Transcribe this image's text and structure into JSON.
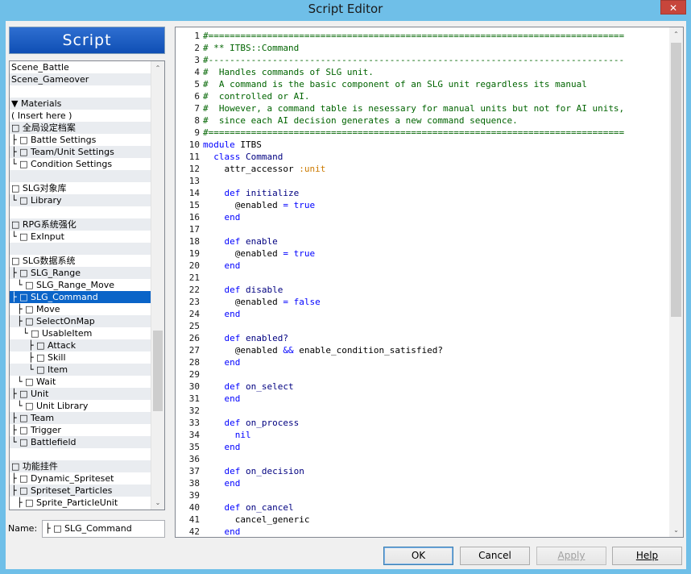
{
  "window": {
    "title": "Script Editor",
    "close_glyph": "✕"
  },
  "banner": {
    "label": "Script"
  },
  "script_list": {
    "items": [
      {
        "label": "Scene_Battle",
        "style": "normal"
      },
      {
        "label": "Scene_Gameover",
        "style": "alt"
      },
      {
        "label": "",
        "style": "normal"
      },
      {
        "label": "▼ Materials",
        "style": "alt"
      },
      {
        "label": "( Insert here )",
        "style": "normal"
      },
      {
        "label": "□ 全局设定档案",
        "style": "alt"
      },
      {
        "label": "├ □ Battle Settings",
        "style": "normal"
      },
      {
        "label": "├ □ Team/Unit Settings",
        "style": "alt"
      },
      {
        "label": "└ □ Condition Settings",
        "style": "normal"
      },
      {
        "label": "",
        "style": "alt"
      },
      {
        "label": "□ SLG对象库",
        "style": "normal"
      },
      {
        "label": "└ □ Library",
        "style": "alt"
      },
      {
        "label": "",
        "style": "normal"
      },
      {
        "label": "□ RPG系统强化",
        "style": "alt"
      },
      {
        "label": "└ □ ExInput",
        "style": "normal"
      },
      {
        "label": "",
        "style": "alt"
      },
      {
        "label": "□ SLG数据系统",
        "style": "normal"
      },
      {
        "label": "├ □ SLG_Range",
        "style": "alt"
      },
      {
        "label": "  └ □ SLG_Range_Move",
        "style": "normal"
      },
      {
        "label": "├ □ SLG_Command",
        "style": "sel"
      },
      {
        "label": "  ├ □ Move",
        "style": "normal"
      },
      {
        "label": "  ├ □ SelectOnMap",
        "style": "alt"
      },
      {
        "label": "    └ □ UsableItem",
        "style": "normal"
      },
      {
        "label": "      ├ □ Attack",
        "style": "alt"
      },
      {
        "label": "      ├ □ Skill",
        "style": "normal"
      },
      {
        "label": "      └ □ Item",
        "style": "alt"
      },
      {
        "label": "  └ □ Wait",
        "style": "normal"
      },
      {
        "label": "├ □ Unit",
        "style": "alt"
      },
      {
        "label": "  └ □ Unit Library",
        "style": "normal"
      },
      {
        "label": "├ □ Team",
        "style": "alt"
      },
      {
        "label": "├ □ Trigger",
        "style": "normal"
      },
      {
        "label": "└ □ Battlefield",
        "style": "alt"
      },
      {
        "label": "",
        "style": "normal"
      },
      {
        "label": "□ 功能挂件",
        "style": "alt"
      },
      {
        "label": "├ □ Dynamic_Spriteset",
        "style": "normal"
      },
      {
        "label": "├ □ Spriteset_Particles",
        "style": "alt"
      },
      {
        "label": "  ├ □ Sprite_ParticleUnit",
        "style": "normal"
      }
    ],
    "scroll_up_glyph": "⌃",
    "scroll_down_glyph": "⌄",
    "scroll_position": 0.75
  },
  "name_field": {
    "label": "Name:",
    "value": "├ □ SLG_Command"
  },
  "editor": {
    "lines": [
      {
        "n": "1",
        "segs": [
          {
            "t": "#==============================================================================",
            "c": "cm"
          }
        ]
      },
      {
        "n": "2",
        "segs": [
          {
            "t": "# ** ITBS::Command",
            "c": "cm"
          }
        ]
      },
      {
        "n": "3",
        "segs": [
          {
            "t": "#------------------------------------------------------------------------------",
            "c": "cm"
          }
        ]
      },
      {
        "n": "4",
        "segs": [
          {
            "t": "#  Handles commands of SLG unit.",
            "c": "cm"
          }
        ]
      },
      {
        "n": "5",
        "segs": [
          {
            "t": "#  A command is the basic component of an SLG unit regardless its manual",
            "c": "cm"
          }
        ]
      },
      {
        "n": "6",
        "segs": [
          {
            "t": "#  controlled or AI.",
            "c": "cm"
          }
        ]
      },
      {
        "n": "7",
        "segs": [
          {
            "t": "#  However, a command table is nesessary for manual units but not for AI units,",
            "c": "cm"
          }
        ]
      },
      {
        "n": "8",
        "segs": [
          {
            "t": "#  since each AI decision generates a new command sequence.",
            "c": "cm"
          }
        ]
      },
      {
        "n": "9",
        "segs": [
          {
            "t": "#==============================================================================",
            "c": "cm"
          }
        ]
      },
      {
        "n": "10",
        "segs": [
          {
            "t": "module",
            "c": "kw"
          },
          {
            "t": " ITBS",
            "c": ""
          }
        ]
      },
      {
        "n": "11",
        "segs": [
          {
            "t": "  class",
            "c": "kw"
          },
          {
            "t": " Command",
            "c": "ct"
          }
        ]
      },
      {
        "n": "12",
        "segs": [
          {
            "t": "    attr_accessor ",
            "c": ""
          },
          {
            "t": ":unit",
            "c": "sy"
          }
        ]
      },
      {
        "n": "13",
        "segs": [
          {
            "t": "",
            "c": ""
          }
        ]
      },
      {
        "n": "14",
        "segs": [
          {
            "t": "    def",
            "c": "kw"
          },
          {
            "t": " initialize",
            "c": "ct"
          }
        ]
      },
      {
        "n": "15",
        "segs": [
          {
            "t": "      @enabled ",
            "c": ""
          },
          {
            "t": "=",
            "c": "op"
          },
          {
            "t": " true",
            "c": "kw"
          }
        ]
      },
      {
        "n": "16",
        "segs": [
          {
            "t": "    end",
            "c": "kw"
          }
        ]
      },
      {
        "n": "17",
        "segs": [
          {
            "t": "",
            "c": ""
          }
        ]
      },
      {
        "n": "18",
        "segs": [
          {
            "t": "    def",
            "c": "kw"
          },
          {
            "t": " enable",
            "c": "ct"
          }
        ]
      },
      {
        "n": "19",
        "segs": [
          {
            "t": "      @enabled ",
            "c": ""
          },
          {
            "t": "=",
            "c": "op"
          },
          {
            "t": " true",
            "c": "kw"
          }
        ]
      },
      {
        "n": "20",
        "segs": [
          {
            "t": "    end",
            "c": "kw"
          }
        ]
      },
      {
        "n": "21",
        "segs": [
          {
            "t": "",
            "c": ""
          }
        ]
      },
      {
        "n": "22",
        "segs": [
          {
            "t": "    def",
            "c": "kw"
          },
          {
            "t": " disable",
            "c": "ct"
          }
        ]
      },
      {
        "n": "23",
        "segs": [
          {
            "t": "      @enabled ",
            "c": ""
          },
          {
            "t": "=",
            "c": "op"
          },
          {
            "t": " false",
            "c": "kw"
          }
        ]
      },
      {
        "n": "24",
        "segs": [
          {
            "t": "    end",
            "c": "kw"
          }
        ]
      },
      {
        "n": "25",
        "segs": [
          {
            "t": "",
            "c": ""
          }
        ]
      },
      {
        "n": "26",
        "segs": [
          {
            "t": "    def",
            "c": "kw"
          },
          {
            "t": " enabled?",
            "c": "ct"
          }
        ]
      },
      {
        "n": "27",
        "segs": [
          {
            "t": "      @enabled ",
            "c": ""
          },
          {
            "t": "&&",
            "c": "op"
          },
          {
            "t": " enable_condition_satisfied?",
            "c": ""
          }
        ]
      },
      {
        "n": "28",
        "segs": [
          {
            "t": "    end",
            "c": "kw"
          }
        ]
      },
      {
        "n": "29",
        "segs": [
          {
            "t": "",
            "c": ""
          }
        ]
      },
      {
        "n": "30",
        "segs": [
          {
            "t": "    def",
            "c": "kw"
          },
          {
            "t": " on_select",
            "c": "ct"
          }
        ]
      },
      {
        "n": "31",
        "segs": [
          {
            "t": "    end",
            "c": "kw"
          }
        ]
      },
      {
        "n": "32",
        "segs": [
          {
            "t": "",
            "c": ""
          }
        ]
      },
      {
        "n": "33",
        "segs": [
          {
            "t": "    def",
            "c": "kw"
          },
          {
            "t": " on_process",
            "c": "ct"
          }
        ]
      },
      {
        "n": "34",
        "segs": [
          {
            "t": "      nil",
            "c": "kw"
          }
        ]
      },
      {
        "n": "35",
        "segs": [
          {
            "t": "    end",
            "c": "kw"
          }
        ]
      },
      {
        "n": "36",
        "segs": [
          {
            "t": "",
            "c": ""
          }
        ]
      },
      {
        "n": "37",
        "segs": [
          {
            "t": "    def",
            "c": "kw"
          },
          {
            "t": " on_decision",
            "c": "ct"
          }
        ]
      },
      {
        "n": "38",
        "segs": [
          {
            "t": "    end",
            "c": "kw"
          }
        ]
      },
      {
        "n": "39",
        "segs": [
          {
            "t": "",
            "c": ""
          }
        ]
      },
      {
        "n": "40",
        "segs": [
          {
            "t": "    def",
            "c": "kw"
          },
          {
            "t": " on_cancel",
            "c": "ct"
          }
        ]
      },
      {
        "n": "41",
        "segs": [
          {
            "t": "      cancel_generic",
            "c": ""
          }
        ]
      },
      {
        "n": "42",
        "segs": [
          {
            "t": "    end",
            "c": "kw"
          }
        ]
      }
    ],
    "scroll_up_glyph": "⌃",
    "scroll_down_glyph": "⌄"
  },
  "buttons": {
    "ok": "OK",
    "cancel": "Cancel",
    "apply": "Apply",
    "help": "Help"
  },
  "colors": {
    "title_bar": "#6fbfe8",
    "selection": "#0a64c8",
    "comment": "#006400",
    "keyword": "#0000ff",
    "symbol": "#cc7a00"
  }
}
